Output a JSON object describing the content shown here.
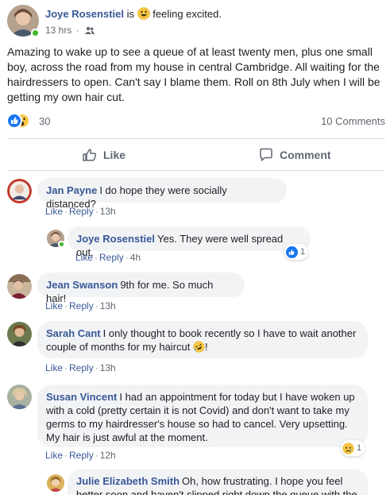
{
  "post": {
    "author": "Joye Rosenstiel",
    "is_word": "is",
    "feeling": "feeling excited.",
    "time": "13 hrs",
    "privacy_icon": "friends-icon",
    "body": "Amazing to wake up to see a queue of at least twenty men, plus one small boy, across the road from my house in central Cambridge. All waiting for the hairdressers to open. Can't say I blame them. Roll on 8th July when I will be getting my own hair cut.",
    "reaction_count": "30",
    "comments_count": "10 Comments",
    "like_label": "Like",
    "comment_label": "Comment"
  },
  "comments": [
    {
      "author": "Jan Payne",
      "text": "I do hope they were socially distanced?",
      "like": "Like",
      "reply": "Reply",
      "time": "13h"
    },
    {
      "author": "Joye Rosenstiel",
      "text": "Yes. They were well spread out.",
      "like": "Like",
      "reply": "Reply",
      "time": "4h",
      "reaction_count": "1"
    },
    {
      "author": "Jean Swanson",
      "text": "9th for me. So much hair!",
      "like": "Like",
      "reply": "Reply",
      "time": "13h"
    },
    {
      "author": "Sarah Cant",
      "text": "I only thought to book recently so I have to wait another couple of months for my haircut",
      "text_end": "!",
      "like": "Like",
      "reply": "Reply",
      "time": "13h"
    },
    {
      "author": "Susan Vincent",
      "text": "I had an appointment for today but I have woken up with a cold (pretty certain it is not Covid) and don't want to take my germs to my hairdresser's house so had to cancel. Very upsetting. My hair is just awful at the moment.",
      "like": "Like",
      "reply": "Reply",
      "time": "12h",
      "reaction_count": "1"
    },
    {
      "author": "Julie Elizabeth Smith",
      "text": "Oh, how frustrating. I hope you feel better soon and haven't slipped right down the queue with the"
    }
  ],
  "colors": {
    "name_blue": "#385898",
    "bubble_bg": "#f2f3f5",
    "muted": "#606770",
    "like_blue": "#1877f2",
    "online_green": "#42b72a"
  }
}
